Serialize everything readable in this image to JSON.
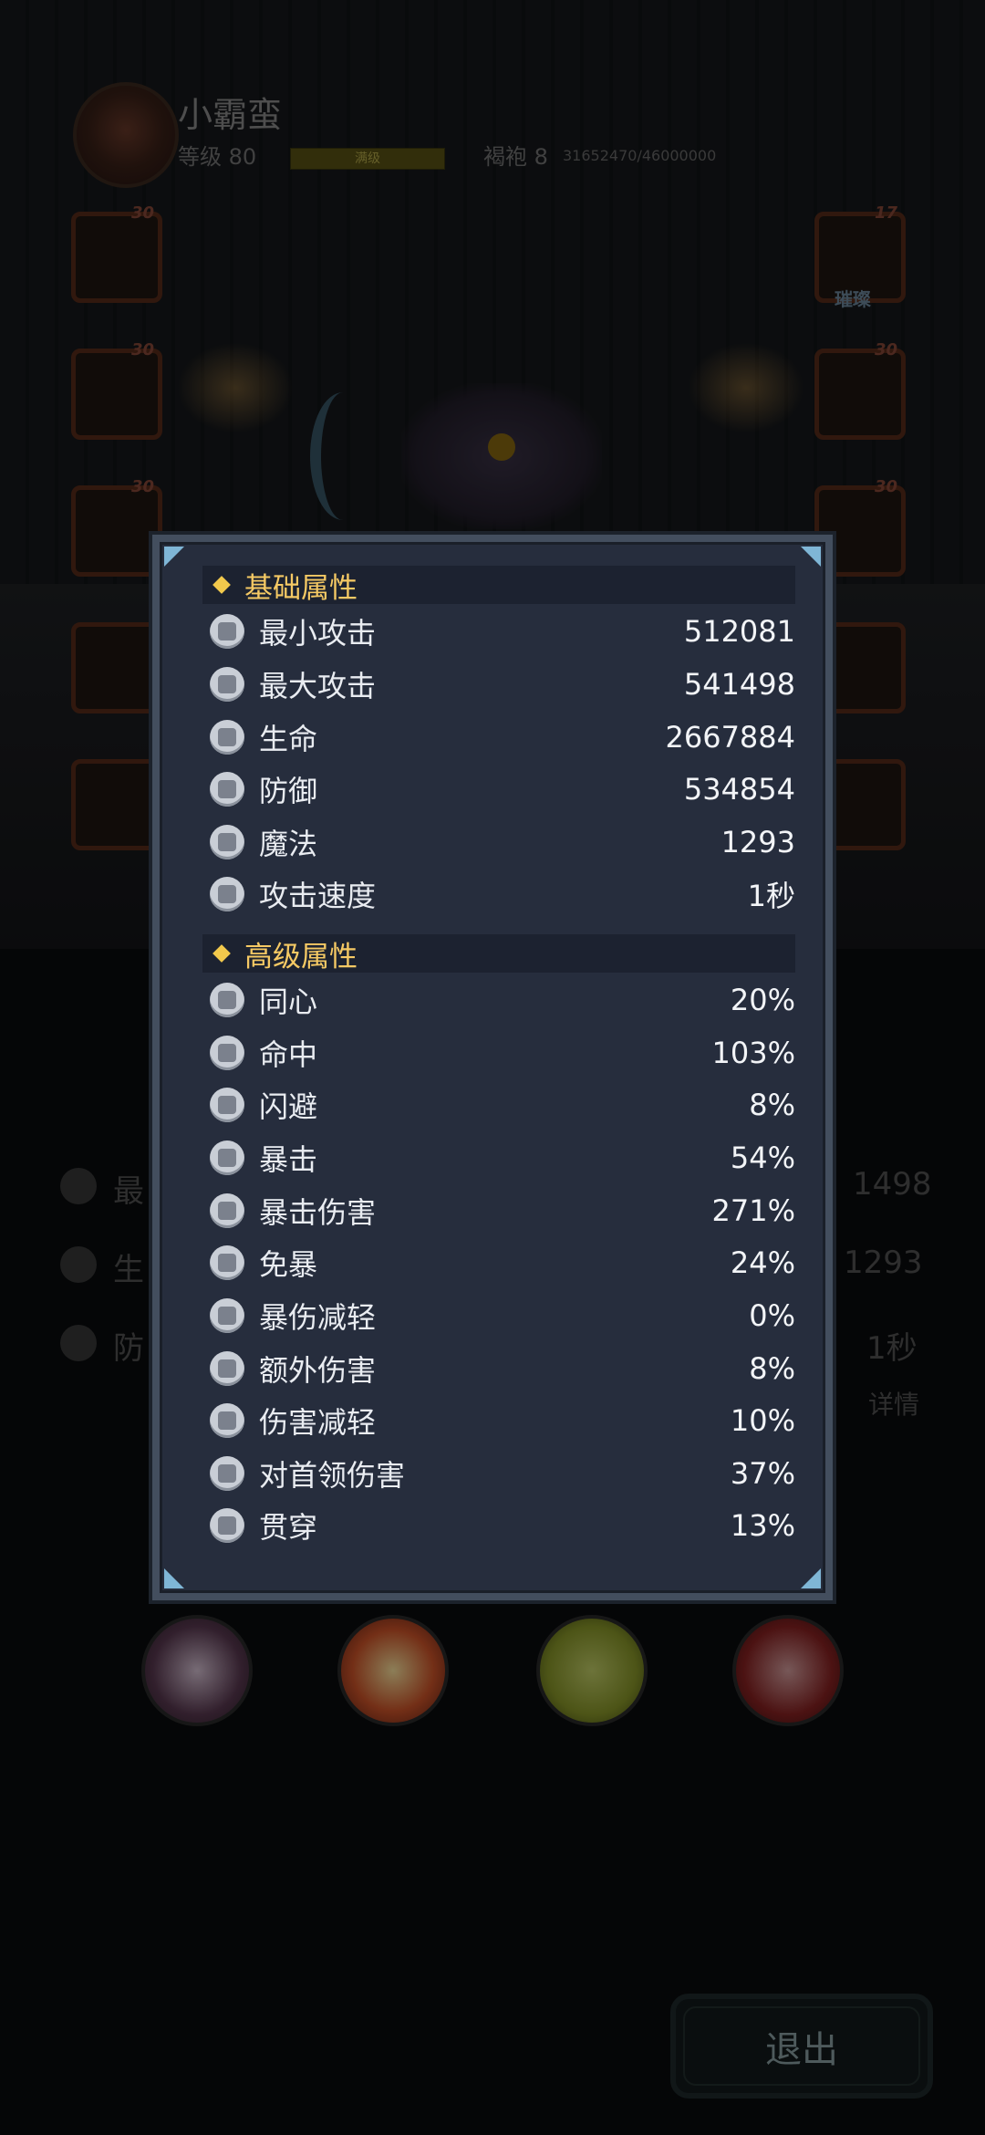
{
  "header": {
    "name": "小霸蛮",
    "level_text": "等级 80",
    "level_bar_text": "满级",
    "robe_text": "褐袍 8",
    "exp_text": "31652470/46000000"
  },
  "equipment": {
    "left_levels": [
      "30",
      "30",
      "30",
      "",
      ""
    ],
    "right_levels": [
      "17",
      "30",
      "30",
      "",
      ""
    ],
    "right_top_tag": "璀璨"
  },
  "background_stats": {
    "rows": [
      {
        "label": "最",
        "value": "1498"
      },
      {
        "label": "生",
        "value": "1293"
      },
      {
        "label": "防",
        "value": "1秒"
      }
    ],
    "details_label": "详情"
  },
  "panel": {
    "basic_title": "基础属性",
    "basic": [
      {
        "icon": "sword-icon",
        "label": "最小攻击",
        "value": "512081"
      },
      {
        "icon": "sword-icon",
        "label": "最大攻击",
        "value": "541498"
      },
      {
        "icon": "heart-icon",
        "label": "生命",
        "value": "2667884"
      },
      {
        "icon": "shield-icon",
        "label": "防御",
        "value": "534854"
      },
      {
        "icon": "magic-icon",
        "label": "魔法",
        "value": "1293"
      },
      {
        "icon": "speed-icon",
        "label": "攻击速度",
        "value": "1秒"
      }
    ],
    "advanced_title": "高级属性",
    "advanced": [
      {
        "icon": "scroll-icon",
        "label": "同心",
        "value": "20%"
      },
      {
        "icon": "target-icon",
        "label": "命中",
        "value": "103%"
      },
      {
        "icon": "dodge-icon",
        "label": "闪避",
        "value": "8%"
      },
      {
        "icon": "crit-icon",
        "label": "暴击",
        "value": "54%"
      },
      {
        "icon": "burst-icon",
        "label": "暴击伤害",
        "value": "271%"
      },
      {
        "icon": "crit-immune-icon",
        "label": "免暴",
        "value": "24%"
      },
      {
        "icon": "crit-reduce-icon",
        "label": "暴伤减轻",
        "value": "0%"
      },
      {
        "icon": "extra-damage-icon",
        "label": "额外伤害",
        "value": "8%"
      },
      {
        "icon": "armor-icon",
        "label": "伤害减轻",
        "value": "10%"
      },
      {
        "icon": "boss-icon",
        "label": "对首领伤害",
        "value": "37%"
      },
      {
        "icon": "pierce-icon",
        "label": "贯穿",
        "value": "13%"
      }
    ]
  },
  "footer": {
    "exit_label": "退出"
  }
}
